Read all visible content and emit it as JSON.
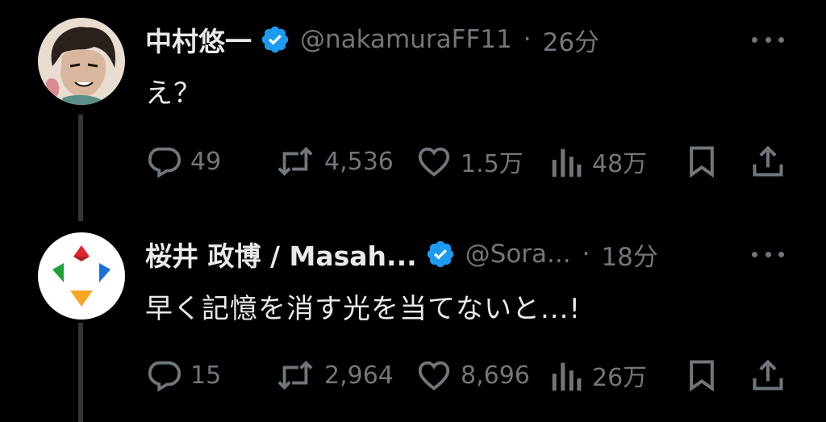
{
  "tweets": [
    {
      "name": "中村悠一",
      "handle": "@nakamuraFF11",
      "separator": "·",
      "time": "26分",
      "text": "え？",
      "verified": true,
      "stats": {
        "replies": "49",
        "reposts": "4,536",
        "likes": "1.5万",
        "views": "48万"
      }
    },
    {
      "name": "桜井 政博 / Masah...",
      "handle": "@Sora...",
      "separator": "·",
      "time": "18分",
      "text": "早く記憶を消す光を当てないと...!",
      "verified": true,
      "stats": {
        "replies": "15",
        "reposts": "2,964",
        "likes": "8,696",
        "views": "26万"
      }
    }
  ],
  "colors": {
    "background": "#000000",
    "primary_text": "#e7e9ea",
    "secondary_text": "#71767b",
    "verified_blue": "#1d9bf0",
    "thread_line": "#333639"
  },
  "icons": {
    "reply": "speech-bubble-icon",
    "repost": "repost-arrows-icon",
    "like": "heart-icon",
    "views": "bar-chart-icon",
    "bookmark": "bookmark-icon",
    "share": "share-upload-icon",
    "more": "more-dots-icon",
    "verified": "verified-badge-icon"
  }
}
